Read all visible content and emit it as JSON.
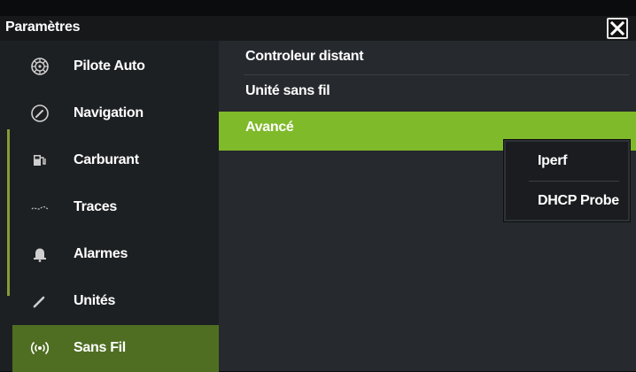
{
  "window": {
    "title": "Paramètres",
    "close_icon": "close-icon"
  },
  "sidebar": {
    "items": [
      {
        "label": "Pilote Auto",
        "icon": "steering-wheel-icon",
        "active": false
      },
      {
        "label": "Navigation",
        "icon": "compass-icon",
        "active": false
      },
      {
        "label": "Carburant",
        "icon": "fuel-pump-icon",
        "active": false
      },
      {
        "label": "Traces",
        "icon": "track-icon",
        "active": false
      },
      {
        "label": "Alarmes",
        "icon": "bell-icon",
        "active": false
      },
      {
        "label": "Unités",
        "icon": "pencil-icon",
        "active": false
      },
      {
        "label": "Sans Fil",
        "icon": "wireless-icon",
        "active": true
      }
    ]
  },
  "main": {
    "items": [
      {
        "label": "Controleur distant",
        "highlighted": false
      },
      {
        "label": "Unité sans fil",
        "highlighted": false
      },
      {
        "label": "Avancé",
        "highlighted": true
      }
    ]
  },
  "submenu": {
    "items": [
      {
        "label": "Iperf"
      },
      {
        "label": "DHCP Probe"
      }
    ]
  },
  "colors": {
    "accent_green": "#7fba2a",
    "active_sidebar": "#4f6e22",
    "background": "#26292d"
  }
}
